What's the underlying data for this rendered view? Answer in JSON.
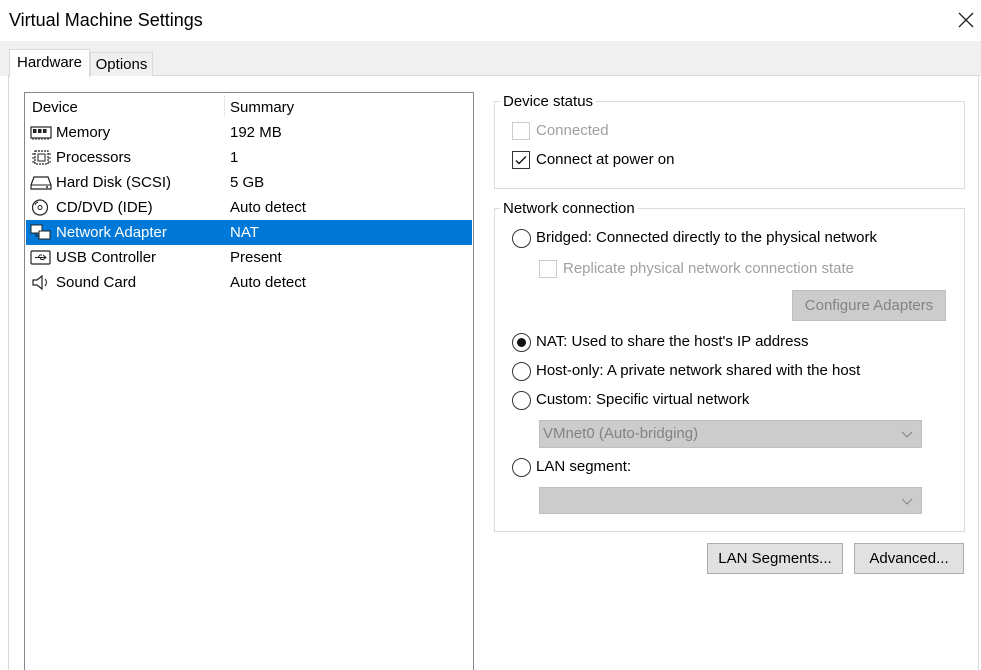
{
  "window": {
    "title": "Virtual Machine Settings"
  },
  "tabs": {
    "hardware": "Hardware",
    "options": "Options"
  },
  "device_list": {
    "header": {
      "device": "Device",
      "summary": "Summary"
    },
    "rows": [
      {
        "name": "Memory",
        "summary": "192 MB",
        "icon": "memory-icon"
      },
      {
        "name": "Processors",
        "summary": "1",
        "icon": "processor-icon"
      },
      {
        "name": "Hard Disk (SCSI)",
        "summary": "5 GB",
        "icon": "hard-disk-icon"
      },
      {
        "name": "CD/DVD (IDE)",
        "summary": "Auto detect",
        "icon": "cd-dvd-icon"
      },
      {
        "name": "Network Adapter",
        "summary": "NAT",
        "icon": "network-adapter-icon",
        "selected": true
      },
      {
        "name": "USB Controller",
        "summary": "Present",
        "icon": "usb-icon"
      },
      {
        "name": "Sound Card",
        "summary": "Auto detect",
        "icon": "speaker-icon"
      }
    ]
  },
  "device_status": {
    "label": "Device status",
    "connected": {
      "label": "Connected",
      "checked": false,
      "enabled": false
    },
    "connect_power_on": {
      "label": "Connect at power on",
      "checked": true,
      "enabled": true
    }
  },
  "network_connection": {
    "label": "Network connection",
    "bridged": "Bridged: Connected directly to the physical network",
    "replicate": "Replicate physical network connection state",
    "configure_adapters": "Configure Adapters",
    "nat": "NAT: Used to share the host's IP address",
    "host_only": "Host-only: A private network shared with the host",
    "custom": "Custom: Specific virtual network",
    "custom_value": "VMnet0 (Auto-bridging)",
    "lan_segment": "LAN segment:",
    "lan_segment_value": "",
    "selected": "nat"
  },
  "buttons": {
    "lan_segments": "LAN Segments...",
    "advanced": "Advanced..."
  },
  "colors": {
    "selection": "#0078d7",
    "disabled_text": "#a0a0a0"
  }
}
